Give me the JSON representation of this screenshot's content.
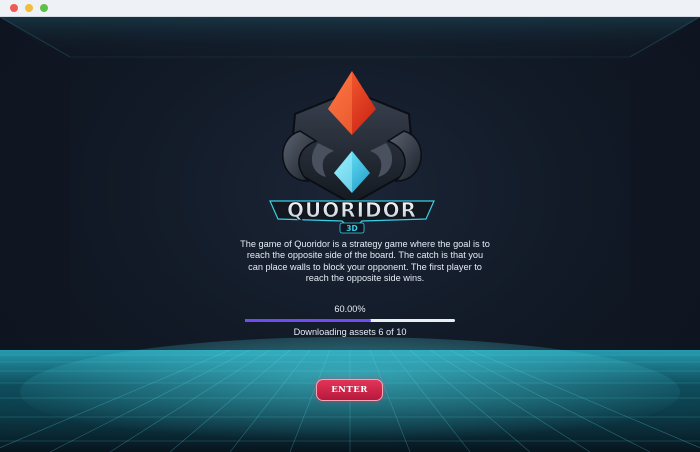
{
  "window": {
    "controls": [
      "close",
      "minimize",
      "maximize"
    ]
  },
  "logo": {
    "text": "QUORIDOR",
    "subtext": "3D",
    "icon": "quoridor-emblem"
  },
  "description": "The game of Quoridor is a strategy game where the goal is to reach the opposite side of the board. The catch is that you can place walls to block your opponent. The first player to reach the opposite side wins.",
  "loading": {
    "percent_text": "60.00%",
    "progress": 0.6,
    "status": "Downloading assets 6 of 10"
  },
  "enter_button": {
    "label": "ENTER"
  },
  "colors": {
    "progress_fill": "#6e4df0",
    "progress_track": "#e9edf4",
    "button": "#d42a4c",
    "floor_glow": "#3fc6d6"
  }
}
